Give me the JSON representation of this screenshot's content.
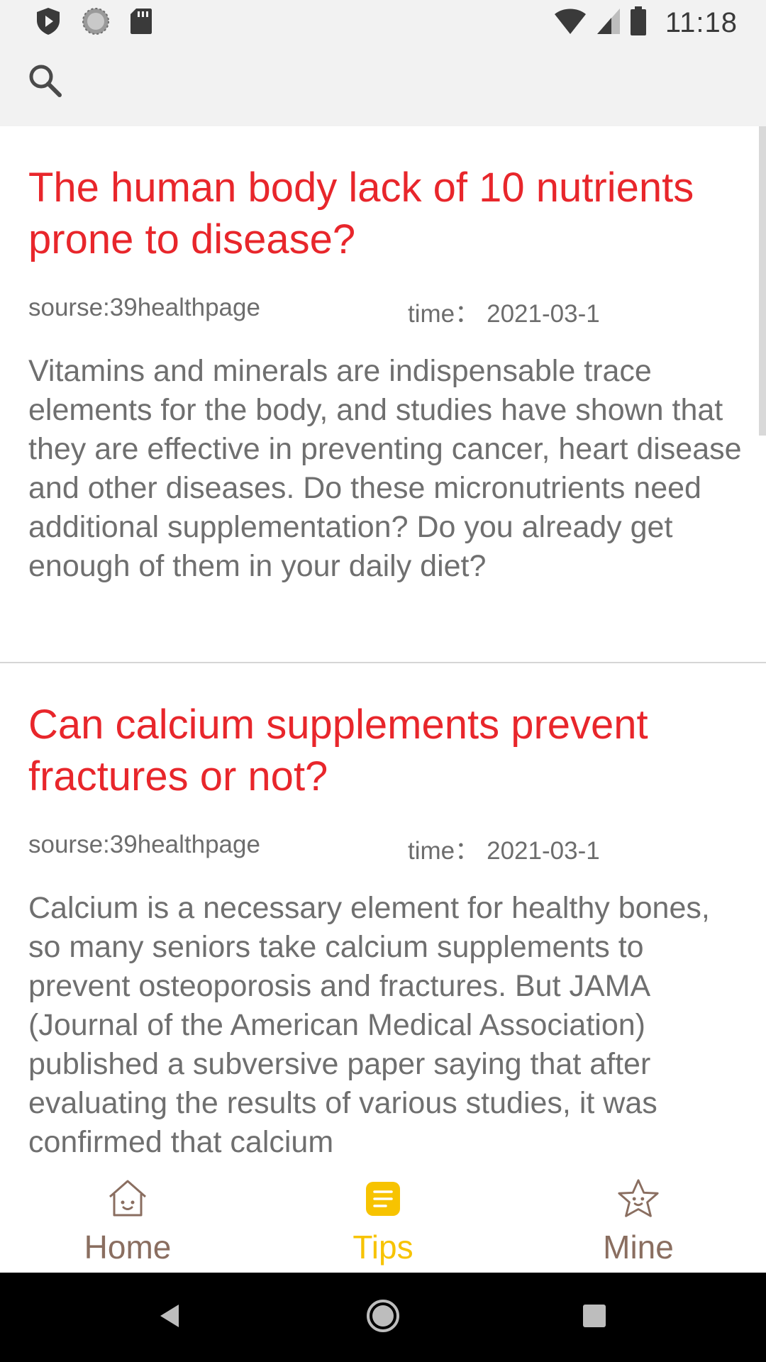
{
  "status_bar": {
    "time": "11:18",
    "left_icons": [
      "shield-play-icon",
      "sync-circle-icon",
      "sd-card-icon"
    ],
    "right_icons": [
      "wifi-icon",
      "cell-signal-icon",
      "battery-icon"
    ]
  },
  "app_bar": {
    "search_icon": "search-icon"
  },
  "articles": [
    {
      "title": "The human body lack of 10 nutrients prone to disease?",
      "source": "sourse:39healthpage",
      "time_label": "time：",
      "time_value": "2021-03-1",
      "body": "Vitamins and minerals are indispensable trace elements for the body, and studies have shown that they are effective in preventing cancer, heart disease and other diseases. Do these micronutrients need additional supplementation? Do you already get enough of them in your daily diet?"
    },
    {
      "title": "Can calcium supplements prevent fractures or not?",
      "source": "sourse:39healthpage",
      "time_label": "time：",
      "time_value": "2021-03-1",
      "body": "Calcium is a necessary element for healthy bones, so many seniors take calcium supplements to prevent osteoporosis and fractures. But JAMA (Journal of the American Medical Association) published a subversive paper saying that after evaluating the results of various studies, it was confirmed that calcium"
    }
  ],
  "bottom_nav": {
    "items": [
      {
        "label": "Home",
        "icon": "house-face-icon",
        "active": false
      },
      {
        "label": "Tips",
        "icon": "tips-list-icon",
        "active": true
      },
      {
        "label": "Mine",
        "icon": "star-face-icon",
        "active": false
      }
    ]
  },
  "system_nav": {
    "buttons": [
      "back-icon",
      "home-circle-icon",
      "recents-square-icon"
    ]
  },
  "colors": {
    "title_red": "#e8262b",
    "active_yellow": "#f7c300",
    "inactive_brown": "#8a6e60",
    "chrome_gray": "#f2f2f2"
  }
}
